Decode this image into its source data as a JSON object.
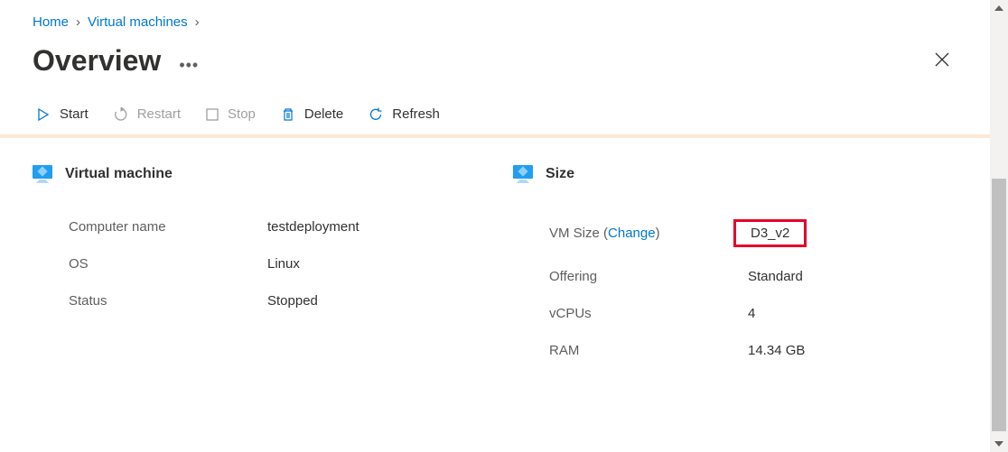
{
  "breadcrumb": {
    "home": "Home",
    "vms": "Virtual machines"
  },
  "title": "Overview",
  "toolbar": {
    "start": "Start",
    "restart": "Restart",
    "stop": "Stop",
    "delete": "Delete",
    "refresh": "Refresh"
  },
  "vm": {
    "heading": "Virtual machine",
    "labels": {
      "computer_name": "Computer name",
      "os": "OS",
      "status": "Status"
    },
    "values": {
      "computer_name": "testdeployment",
      "os": "Linux",
      "status": "Stopped"
    }
  },
  "size": {
    "heading": "Size",
    "labels": {
      "vm_size_prefix": "VM Size (",
      "change": "Change",
      "vm_size_suffix": ")",
      "offering": "Offering",
      "vcpus": "vCPUs",
      "ram": "RAM"
    },
    "values": {
      "vm_size": "D3_v2",
      "offering": "Standard",
      "vcpus": "4",
      "ram": "14.34 GB"
    }
  }
}
